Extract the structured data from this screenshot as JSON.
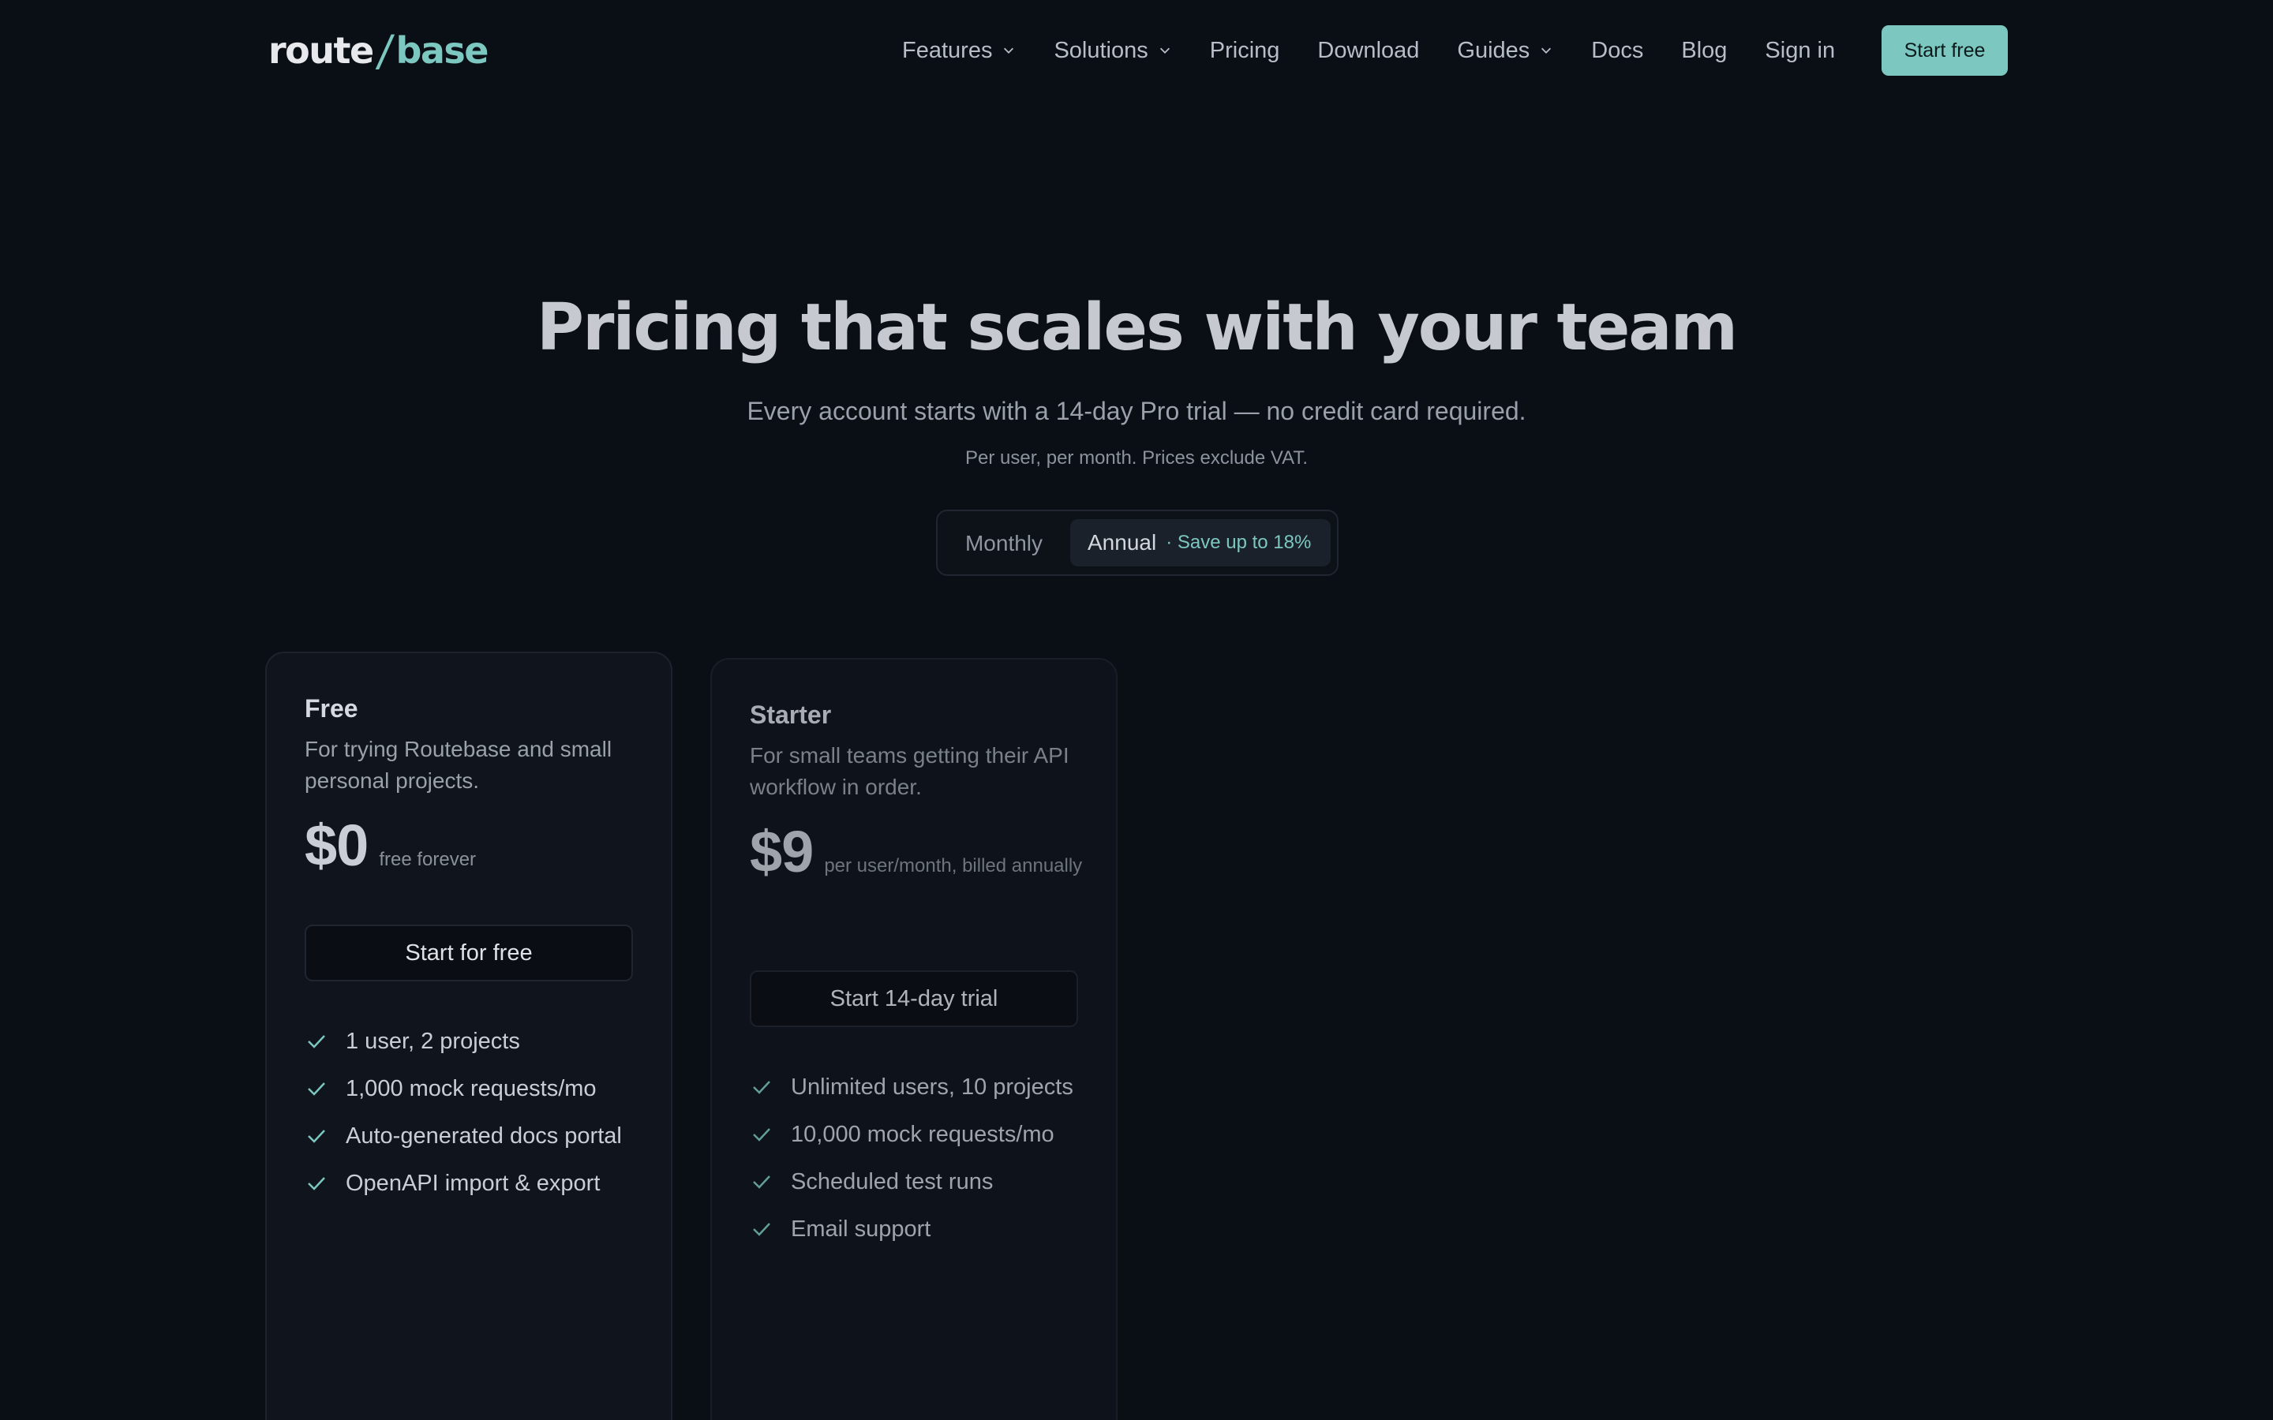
{
  "logo": {
    "word1": "route",
    "slash": "/",
    "word2": "base"
  },
  "nav": {
    "items": [
      {
        "label": "Features",
        "dropdown": true
      },
      {
        "label": "Solutions",
        "dropdown": true
      },
      {
        "label": "Pricing",
        "dropdown": false
      },
      {
        "label": "Download",
        "dropdown": false
      },
      {
        "label": "Guides",
        "dropdown": true
      },
      {
        "label": "Docs",
        "dropdown": false
      },
      {
        "label": "Blog",
        "dropdown": false
      },
      {
        "label": "Sign in",
        "dropdown": false
      }
    ],
    "cta": "Start free"
  },
  "hero": {
    "title": "Pricing that scales with your team",
    "subtitle": "Every account starts with a 14-day Pro trial — no credit card required.",
    "note": "Per user, per month. Prices exclude VAT."
  },
  "billing_toggle": {
    "monthly": "Monthly",
    "annual": "Annual",
    "annual_badge": "· Save up to 18%",
    "selected": "annual"
  },
  "plans": [
    {
      "name": "Free",
      "description": "For trying Routebase and small personal projects.",
      "price": "$0",
      "price_note": "free forever",
      "button": "Start for free",
      "features": [
        "1 user, 2 projects",
        "1,000 mock requests/mo",
        "Auto-generated docs portal",
        "OpenAPI import & export"
      ]
    },
    {
      "name": "Starter",
      "description": "For small teams getting their API workflow in order.",
      "price": "$9",
      "price_note": "per user/month, billed annually",
      "button": "Start 14-day trial",
      "features": [
        "Unlimited users, 10 projects",
        "10,000 mock requests/mo",
        "Scheduled test runs",
        "Email support"
      ]
    }
  ],
  "colors": {
    "background": "#0a0e15",
    "accent": "#7cc7c0",
    "card": "#10141c"
  },
  "icons": {
    "dropdown": "chevron-down-icon",
    "feature": "check-icon"
  }
}
